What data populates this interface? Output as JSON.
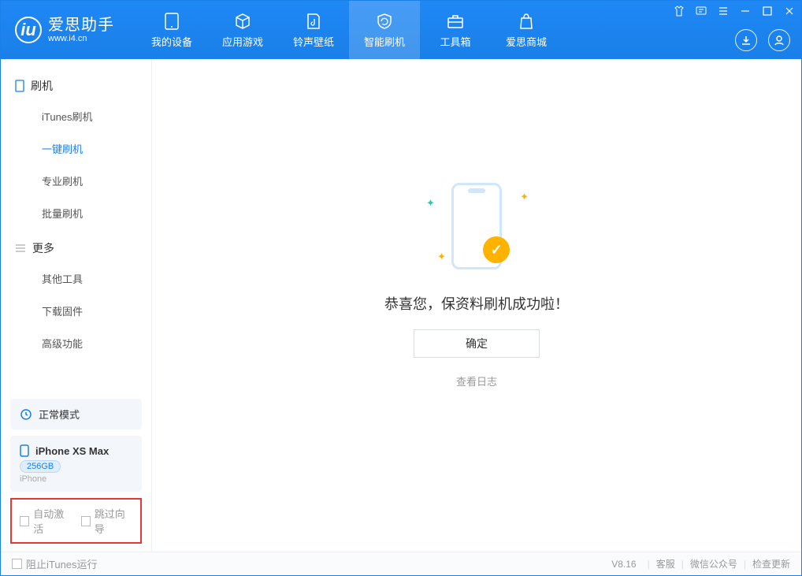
{
  "brand": {
    "cn": "爱思助手",
    "url": "www.i4.cn"
  },
  "nav": {
    "tabs": [
      {
        "label": "我的设备"
      },
      {
        "label": "应用游戏"
      },
      {
        "label": "铃声壁纸"
      },
      {
        "label": "智能刷机"
      },
      {
        "label": "工具箱"
      },
      {
        "label": "爱思商城"
      }
    ],
    "active_index": 3
  },
  "sidebar": {
    "groups": [
      {
        "title": "刷机",
        "items": [
          {
            "label": "iTunes刷机"
          },
          {
            "label": "一键刷机"
          },
          {
            "label": "专业刷机"
          },
          {
            "label": "批量刷机"
          }
        ],
        "active_index": 1
      },
      {
        "title": "更多",
        "items": [
          {
            "label": "其他工具"
          },
          {
            "label": "下载固件"
          },
          {
            "label": "高级功能"
          }
        ]
      }
    ],
    "mode_label": "正常模式",
    "device": {
      "name": "iPhone XS Max",
      "capacity": "256GB",
      "type": "iPhone"
    },
    "options": {
      "auto_activate": "自动激活",
      "skip_wizard": "跳过向导"
    }
  },
  "content": {
    "success_msg": "恭喜您，保资料刷机成功啦！",
    "ok": "确定",
    "view_log": "查看日志"
  },
  "footer": {
    "block_itunes": "阻止iTunes运行",
    "version": "V8.16",
    "links": {
      "support": "客服",
      "wechat": "微信公众号",
      "update": "检查更新"
    }
  }
}
